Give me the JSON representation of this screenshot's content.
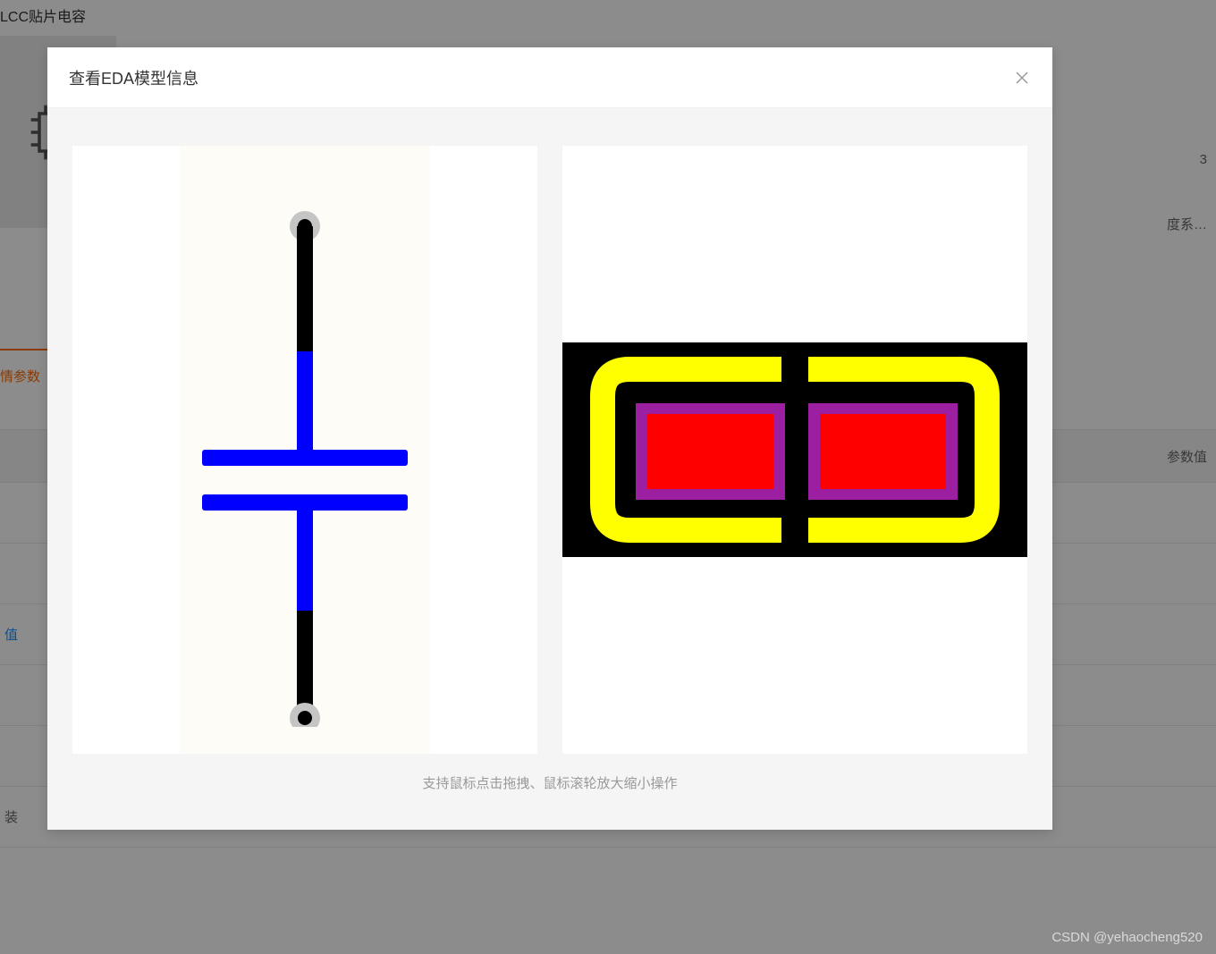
{
  "background": {
    "title": "LCC贴片电容",
    "rightText1": "3",
    "rightText2": "度系…",
    "tabLabel": "情参数",
    "tableHeader": "参数值",
    "rows": [
      "",
      "",
      "值",
      "",
      "",
      "装"
    ],
    "rowLinkIndex": 2
  },
  "modal": {
    "title": "查看EDA模型信息",
    "hint": "支持鼠标点击拖拽、鼠标滚轮放大缩小操作"
  },
  "schematic": {
    "type": "capacitor",
    "pin1": "top",
    "pin2": "bottom"
  },
  "footprint": {
    "type": "smd-2pad",
    "pads": 2,
    "silk_color": "yellow",
    "pad_color": "red",
    "mask_color": "purple"
  },
  "watermark": "CSDN @yehaocheng520"
}
